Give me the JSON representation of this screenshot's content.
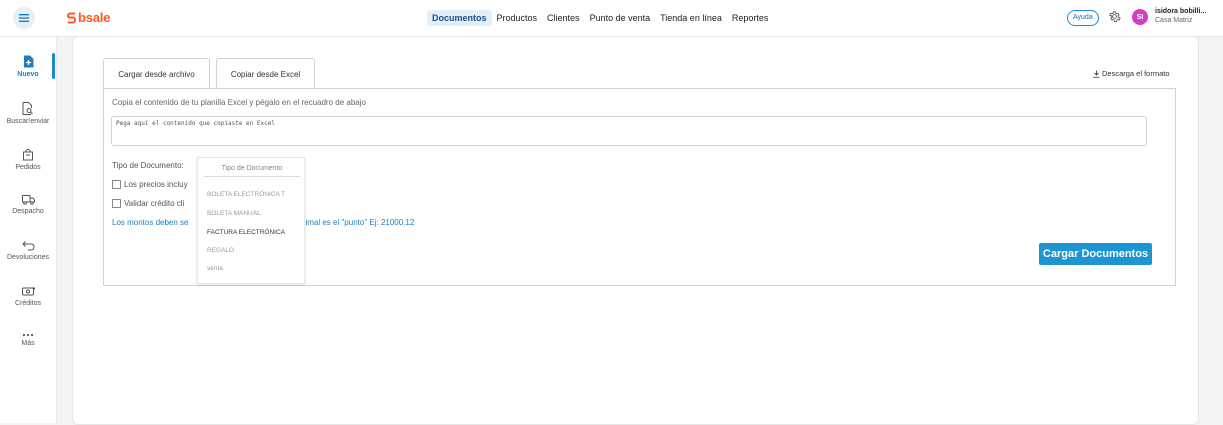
{
  "app": {
    "logo": "bsale",
    "brand_color": "#ff5a1f",
    "accent_color": "#1e95d3"
  },
  "topnav": {
    "items": [
      {
        "label": "Documentos",
        "active": true
      },
      {
        "label": "Productos"
      },
      {
        "label": "Clientes"
      },
      {
        "label": "Punto de venta"
      },
      {
        "label": "Tienda en línea"
      },
      {
        "label": "Reportes"
      }
    ],
    "help": "Ayuda",
    "settings_icon": "gear-icon"
  },
  "user": {
    "initials": "SI",
    "name": "isidora bobilli...",
    "branch": "Casa Matriz"
  },
  "sidebar": {
    "items": [
      {
        "label": "Nuevo",
        "icon": "new-document-icon",
        "active": true
      },
      {
        "label": "Buscar/enviar",
        "icon": "search-document-icon"
      },
      {
        "label": "Pedidos",
        "icon": "bag-icon"
      },
      {
        "label": "Despacho",
        "icon": "truck-icon"
      },
      {
        "label": "Devoluciones",
        "icon": "return-arrow-icon"
      },
      {
        "label": "Créditos",
        "icon": "credit-icon"
      },
      {
        "label": "Más",
        "icon": "more-icon"
      }
    ]
  },
  "tabs": [
    {
      "label": "Cargar desde archivo"
    },
    {
      "label": "Copiar desde Excel",
      "active": true
    }
  ],
  "download_format": "Descarga el formato",
  "form": {
    "instructions": "Copia el contenido de tu planilla Excel y pégalo en el recuadro de abajo",
    "paste_placeholder": "Pega aquí el contenido que copiaste en Excel",
    "document_type_label": "Tipo de Documento:",
    "checkbox_prices": "Los precios incluy",
    "checkbox_credit": "Validar crédito cli",
    "amounts_note_start": "Los montos deben se",
    "amounts_note_end": "ecimal es el \"punto\" Ej: 21000.12",
    "submit": "Cargar Documentos"
  },
  "document_type_dropdown": {
    "header": "Tipo de Documento",
    "options": [
      {
        "label": "BOLETA ELECTRÓNICA T"
      },
      {
        "label": "BOLETA MANUAL"
      },
      {
        "label": "FACTURA ELECTRÓNICA",
        "highlighted": true
      },
      {
        "label": "REGALO"
      },
      {
        "label": "venta"
      }
    ]
  }
}
